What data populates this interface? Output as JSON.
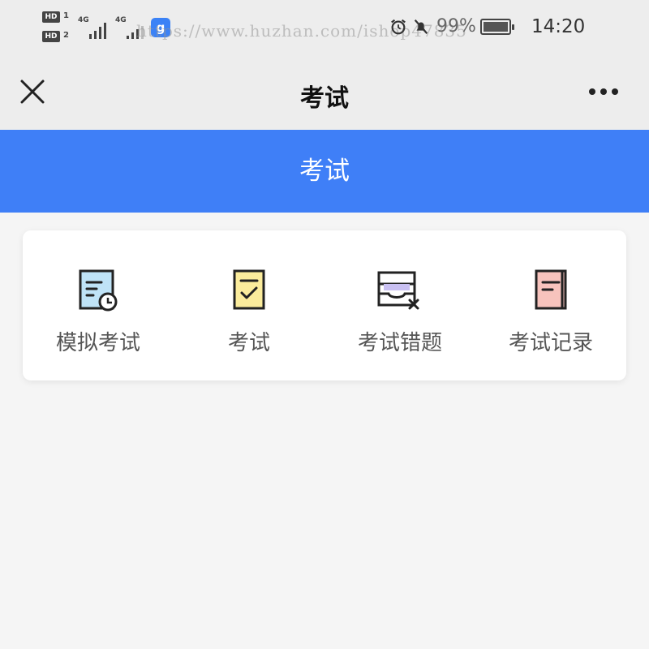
{
  "status_bar": {
    "hd1": "HD",
    "hd1_num": "1",
    "hd2": "HD",
    "hd2_num": "2",
    "net1": "4G",
    "net2": "4G",
    "app_badge": "g",
    "watermark": "https://www.huzhan.com/ishop47835",
    "battery_pct": "99%",
    "battery_level": 0.99,
    "time": "14:20"
  },
  "nav": {
    "title": "考试"
  },
  "banner": {
    "title": "考试"
  },
  "menu": {
    "items": [
      {
        "label": "模拟考试",
        "icon": "document-clock-icon",
        "accent": "#bfe3f7"
      },
      {
        "label": "考试",
        "icon": "checklist-icon",
        "accent": "#fbec9c"
      },
      {
        "label": "考试错题",
        "icon": "tray-x-icon",
        "accent": "#c9c0f2"
      },
      {
        "label": "考试记录",
        "icon": "record-doc-icon",
        "accent": "#f7c3bd"
      }
    ]
  },
  "colors": {
    "primary": "#3f7ff7",
    "background": "#f5f5f5",
    "nav_bg": "#ededed"
  }
}
